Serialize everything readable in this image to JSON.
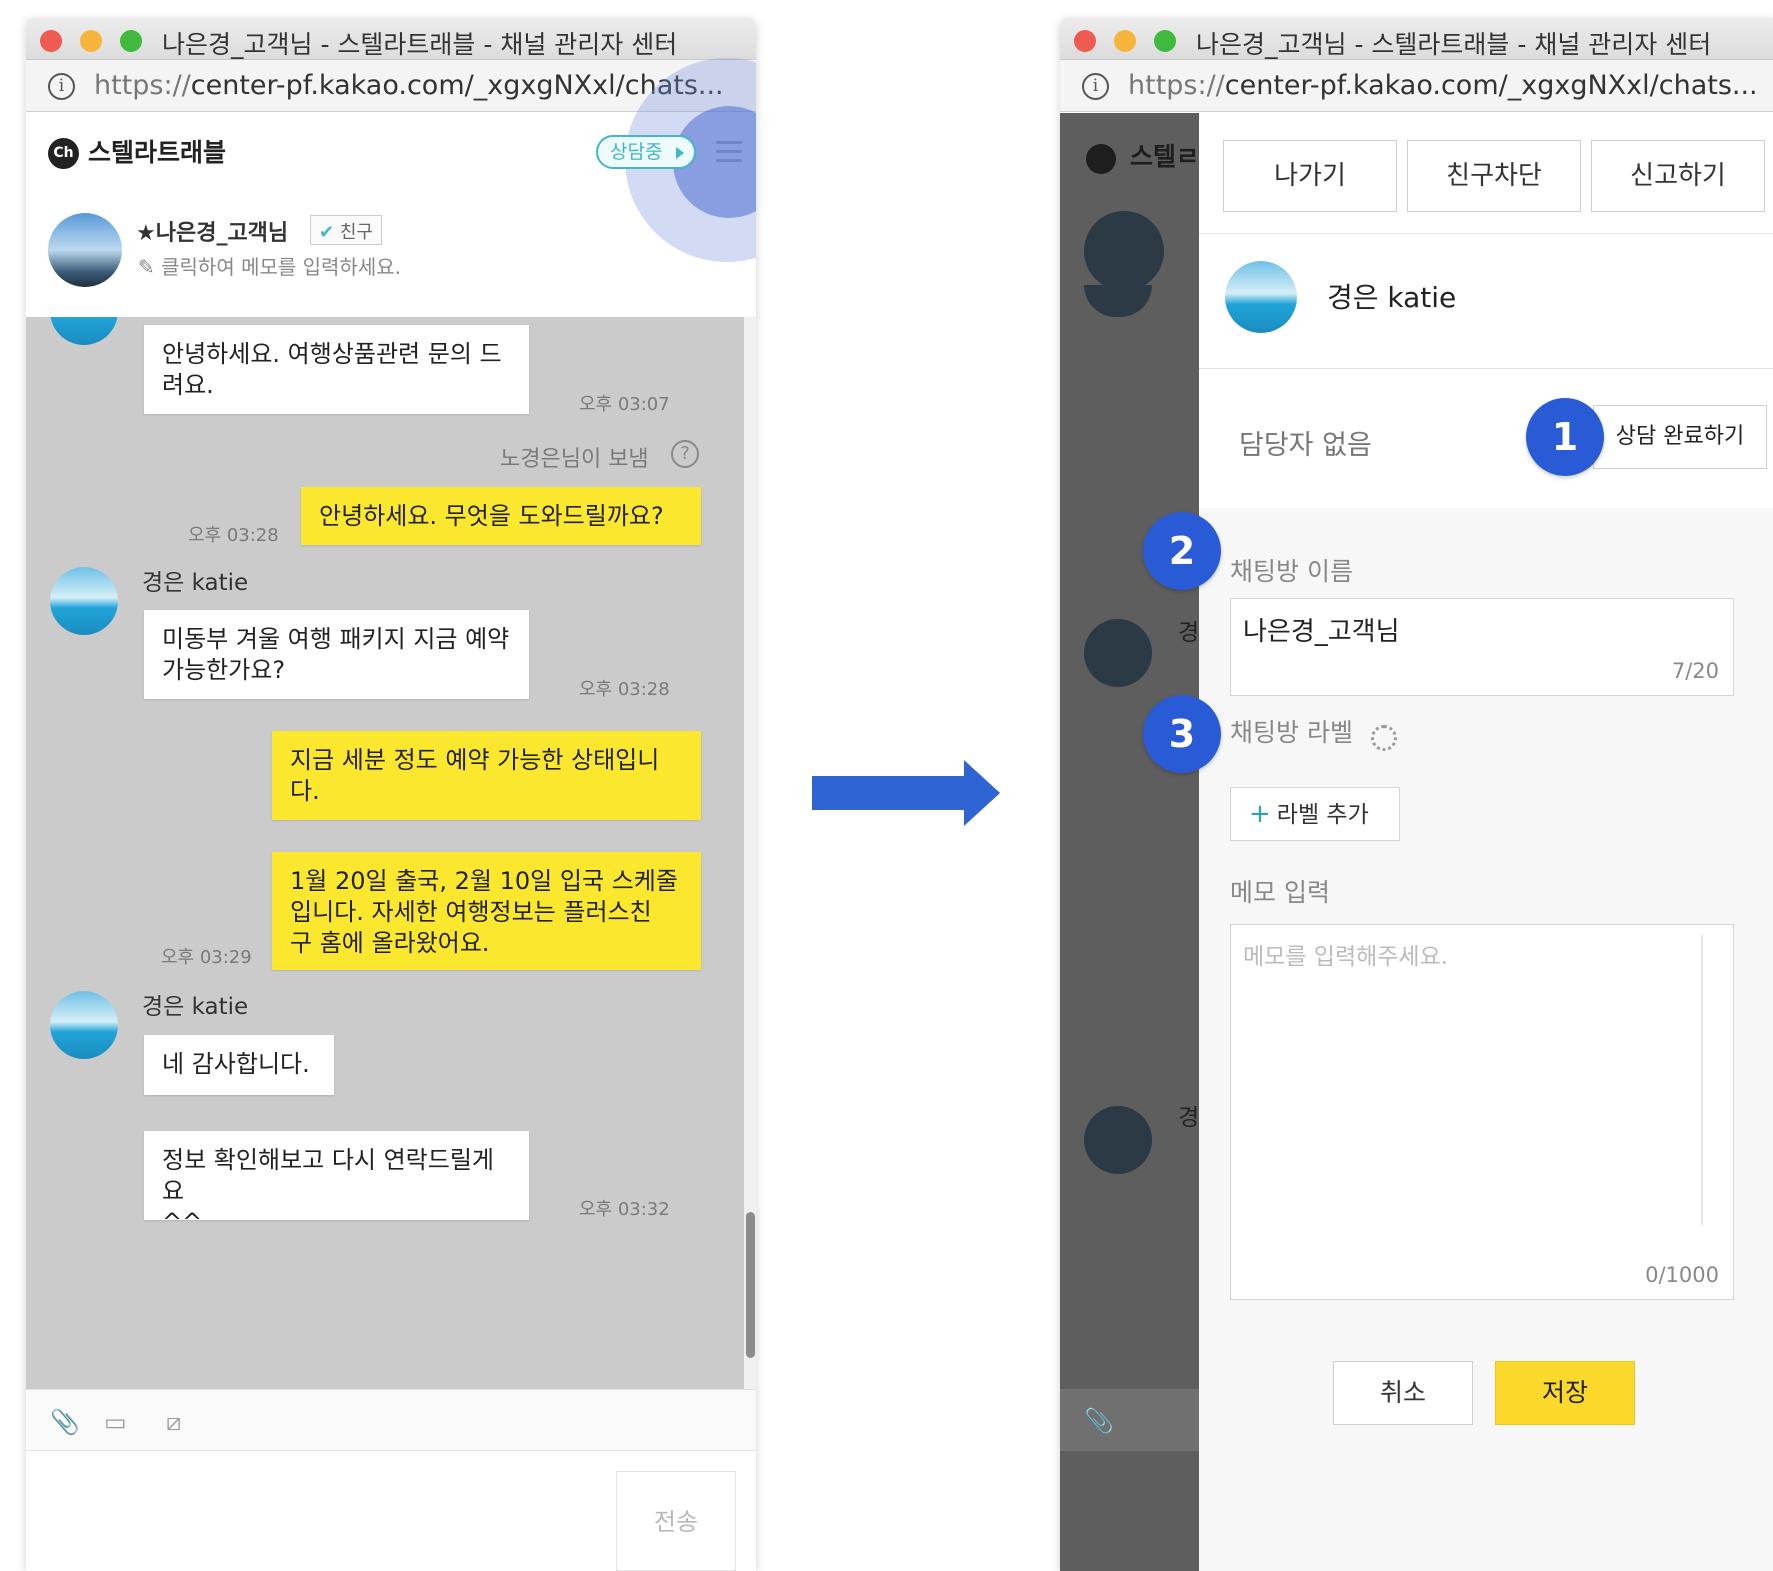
{
  "left_window": {
    "title": "나은경_고객님 - 스텔라트래블 - 채널 관리자 센터",
    "url_proto": "https://",
    "url_rest": "center-pf.kakao.com/_xgxgNXxl/chats...",
    "channel_name": "스텔라트래블",
    "ch_logo": "Ch",
    "status": "상담중",
    "customer_name": "★나은경_고객님",
    "friend_badge": "친구",
    "memo_hint": "클릭하여 메모를 입력하세요.",
    "messages": [
      {
        "text": "안녕하세요. 여행상품관련 문의 드\n려요.",
        "time": "오후 03:07"
      },
      {
        "sent_by": "노경은님이 보냄"
      },
      {
        "text": "안녕하세요. 무엇을 도와드릴까요?",
        "time": "오후 03:28"
      },
      {
        "sender": "경은 katie"
      },
      {
        "text": "미동부 겨울 여행 패키지 지금 예약\n가능한가요?",
        "time": "오후 03:28"
      },
      {
        "text": "지금 세분 정도 예약 가능한 상태입니\n다."
      },
      {
        "text": "1월 20일 출국, 2월 10일 입국 스케줄\n입니다. 자세한 여행정보는 플러스친\n구 홈에 올라왔어요.",
        "time": "오후 03:29"
      },
      {
        "sender": "경은 katie"
      },
      {
        "text": "네 감사합니다."
      },
      {
        "text": "정보 확인해보고 다시 연락드릴게요\n^^",
        "time": "오후 03:32"
      }
    ],
    "send_label": "전송"
  },
  "right_window": {
    "title": "나은경_고객님 - 스텔라트래블 - 채널 관리자 센터",
    "url_proto": "https://",
    "url_rest": "center-pf.kakao.com/_xgxgNXxl/chats...",
    "dim_channel": "스텔ㄹ",
    "dim_initial": "경",
    "buttons": {
      "leave": "나가기",
      "block": "친구차단",
      "report": "신고하기"
    },
    "profile_name": "경은 katie",
    "no_agent": "담당자 없음",
    "complete_label": "상담 완료하기",
    "chat_name_label": "채팅방 이름",
    "chat_name_value": "나은경_고객님",
    "chat_name_counter": "7/20",
    "chat_label_label": "채팅방 라벨",
    "add_label": "라벨 추가",
    "memo_label": "메모 입력",
    "memo_placeholder": "메모를 입력해주세요.",
    "memo_counter": "0/1000",
    "cancel": "취소",
    "save": "저장"
  },
  "steps": [
    "1",
    "2",
    "3"
  ],
  "colors": {
    "accent_blue": "#2a5bd7",
    "bubble_yellow": "#fbe72d",
    "save_yellow": "#fbd92b",
    "status_teal": "#3fb6c9"
  }
}
